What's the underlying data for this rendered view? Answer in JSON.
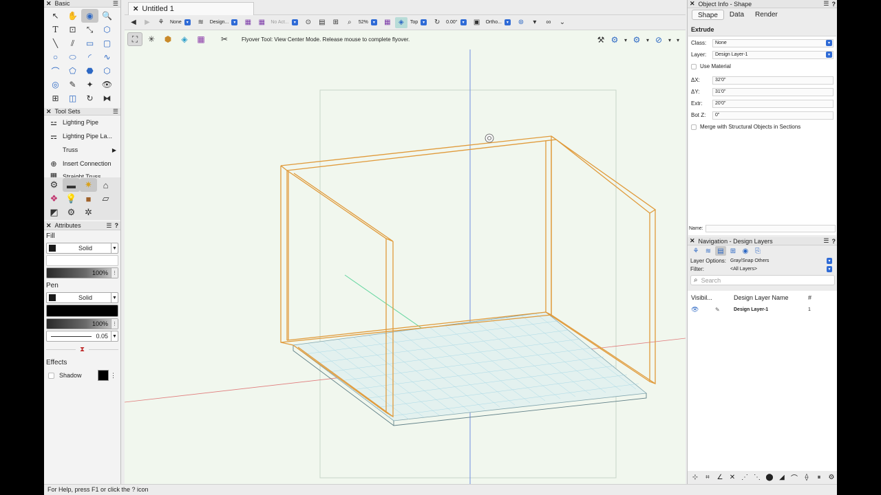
{
  "document": {
    "tab_title": "Untitled 1"
  },
  "palettes": {
    "basic": {
      "title": "Basic"
    },
    "toolsets": {
      "title": "Tool Sets",
      "items": [
        {
          "label": "Lighting Pipe",
          "has_arrow": false
        },
        {
          "label": "Lighting Pipe La...",
          "has_arrow": false
        },
        {
          "label": "Truss",
          "has_arrow": true
        },
        {
          "label": "Insert Connection",
          "has_arrow": false
        },
        {
          "label": "Straight Truss",
          "has_arrow": false
        }
      ]
    },
    "attributes": {
      "title": "Attributes",
      "fill_label": "Fill",
      "fill_style": "Solid",
      "fill_opacity": "100%",
      "pen_label": "Pen",
      "pen_style": "Solid",
      "pen_opacity": "100%",
      "line_weight": "0.05",
      "effects_label": "Effects",
      "shadow_label": "Shadow"
    }
  },
  "view_bar": {
    "class_value": "None",
    "layer_value": "Design...",
    "active_class": "No Act...",
    "zoom": "52%",
    "view": "Top",
    "rotation": "0.00°",
    "projection": "Ortho..."
  },
  "mode_bar": {
    "message": "Flyover Tool: View Center Mode. Release mouse to complete flyover."
  },
  "object_info": {
    "title": "Object Info - Shape",
    "tabs": [
      "Shape",
      "Data",
      "Render"
    ],
    "active_tab": "Shape",
    "object_type": "Extrude",
    "class_label": "Class:",
    "class_value": "None",
    "layer_label": "Layer:",
    "layer_value": "Design Layer-1",
    "use_material": "Use Material",
    "dx_label": "ΔX:",
    "dx_value": "32'0\"",
    "dy_label": "ΔY:",
    "dy_value": "31'0\"",
    "extr_label": "Extr:",
    "extr_value": "20'0\"",
    "botz_label": "Bot Z:",
    "botz_value": "0\"",
    "merge_label": "Merge with Structural Objects in Sections",
    "name_label": "Name:"
  },
  "navigation": {
    "title": "Navigation - Design Layers",
    "layer_options_label": "Layer Options:",
    "layer_options_value": "Gray/Snap Others",
    "filter_label": "Filter:",
    "filter_value": "<All Layers>",
    "search_placeholder": "Search",
    "columns": [
      "Visibil...",
      "Design Layer Name",
      "#"
    ],
    "rows": [
      {
        "name": "Design Layer-1",
        "number": "1"
      }
    ]
  },
  "status": {
    "help_text": "For Help, press F1 or click the ? icon"
  },
  "colors": {
    "canvas_bg": "#f1f7ee",
    "wall_stroke": "#e09a3a",
    "grid": "#9ecfe0",
    "accent_blue": "#2f6bd6"
  }
}
